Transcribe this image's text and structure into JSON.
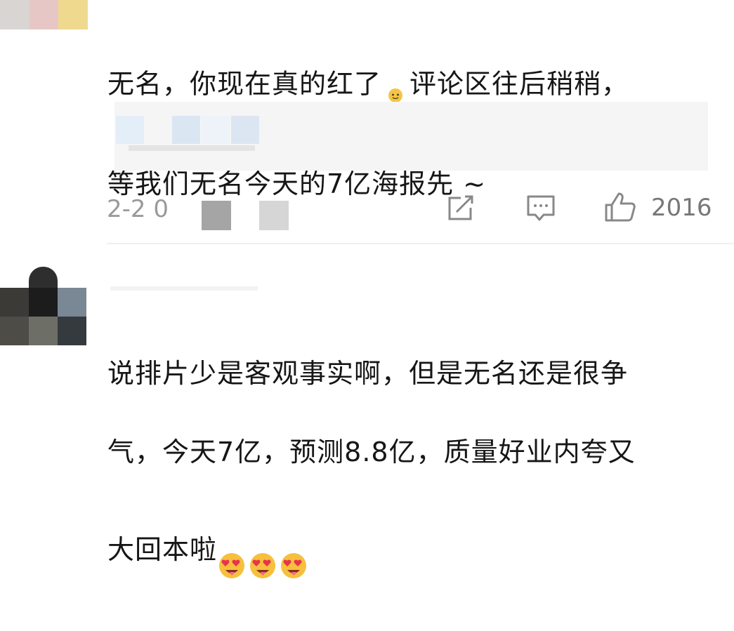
{
  "comments": [
    {
      "text_line1": "无名，你现在真的红了",
      "text_line1b": "评论区往后稍稍，",
      "text_line2": "等我们无名今天的7亿海报先 ~",
      "inline_emoji": "person-emoji",
      "date": "2-2 0",
      "actions": {
        "share_icon": "share-icon",
        "comment_icon": "comment-icon",
        "like_icon": "thumbs-up-icon",
        "like_count": "2016"
      }
    },
    {
      "text_line1": "说排片少是客观事实啊，但是无名还是很争",
      "text_line2": "气，今天7亿，预测8.8亿，质量好业内夸又",
      "text_line3": "大回本啦",
      "trailing_emoji": "heart-eyes-emoji"
    }
  ],
  "colors": {
    "text": "#161616",
    "meta": "#9a9a9a",
    "quote_bg": "#f5f5f5",
    "divider": "#efefef"
  }
}
